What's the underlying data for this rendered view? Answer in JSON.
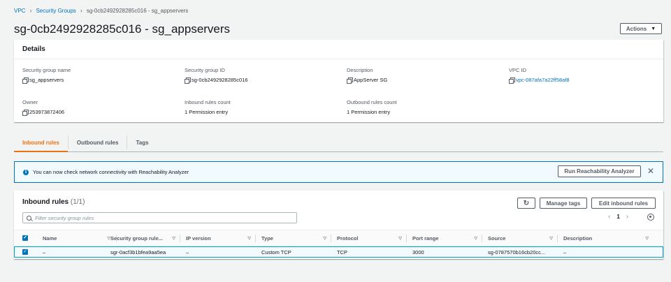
{
  "breadcrumb": {
    "vpc": "VPC",
    "security_groups": "Security Groups",
    "current": "sg-0cb2492928285c016 - sg_appservers"
  },
  "page_title": "sg-0cb2492928285c016 - sg_appservers",
  "actions_label": "Actions",
  "details": {
    "heading": "Details",
    "sg_name_label": "Security group name",
    "sg_name": "sg_appservers",
    "sg_id_label": "Security group ID",
    "sg_id": "sg-0cb2492928285c016",
    "description_label": "Description",
    "description": "AppServer SG",
    "vpc_id_label": "VPC ID",
    "vpc_id": "vpc-087afa7a22ff58af8",
    "owner_label": "Owner",
    "owner": "253973872406",
    "inbound_count_label": "Inbound rules count",
    "inbound_count": "1 Permission entry",
    "outbound_count_label": "Outbound rules count",
    "outbound_count": "1 Permission entry"
  },
  "tabs": [
    "Inbound rules",
    "Outbound rules",
    "Tags"
  ],
  "banner": {
    "text": "You can now check network connectivity with Reachability Analyzer",
    "button": "Run Reachability Analyzer"
  },
  "rules": {
    "title": "Inbound rules",
    "count": "(1/1)",
    "manage_tags": "Manage tags",
    "edit": "Edit inbound rules",
    "filter_placeholder": "Filter security group rules",
    "page": "1",
    "columns": [
      "Name",
      "Security group rule...",
      "IP version",
      "Type",
      "Protocol",
      "Port range",
      "Source",
      "Description"
    ],
    "row": [
      "–",
      "sgr-0acf3b1bfea9aa5ea",
      "–",
      "Custom TCP",
      "TCP",
      "3000",
      "sg-0787570b16cb20cc...",
      "–"
    ]
  },
  "colors": {
    "link": "#0073bb",
    "active_tab": "#ec7211",
    "banner_bg": "#f1faff",
    "selected_row_border": "#00a1c9"
  }
}
